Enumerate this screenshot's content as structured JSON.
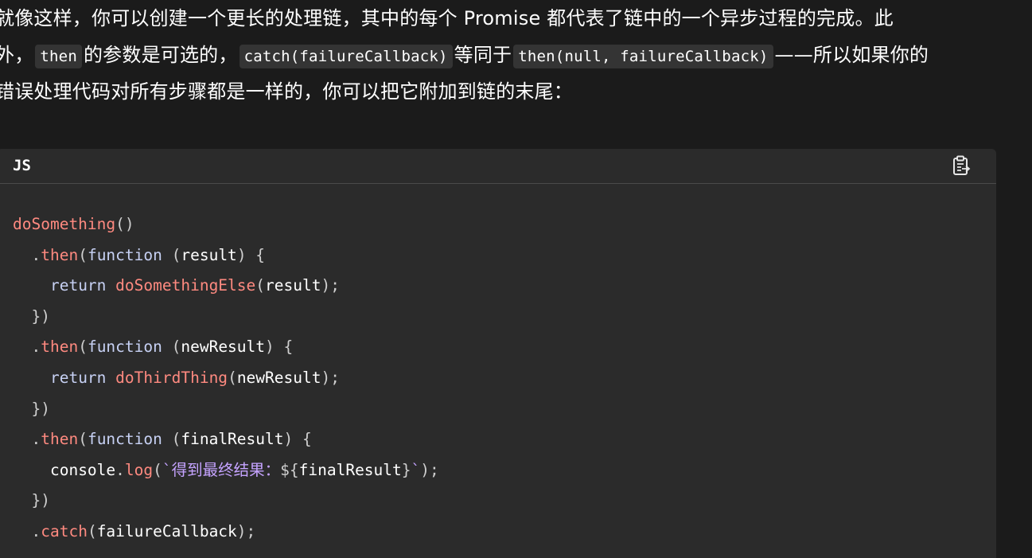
{
  "paragraph": {
    "line1": "就像这样，你可以创建一个更长的处理链，其中的每个 Promise 都代表了链中的一个异步过程的完成。此",
    "line2_pre": "外，",
    "line2_code1": "then",
    "line2_mid1": "的参数是可选的，",
    "line2_code2": "catch(failureCallback)",
    "line2_mid2": "等同于",
    "line2_code3": "then(null, failureCallback)",
    "line2_post": "——所以如果你的",
    "line3": "错误处理代码对所有步骤都是一样的，你可以把它附加到链的末尾："
  },
  "code_block": {
    "language_label": "JS",
    "copy_icon": "clipboard-copy-icon",
    "lines": [
      [
        {
          "t": "doSomething",
          "k": "fn"
        },
        {
          "t": "()",
          "k": "punc"
        }
      ],
      [
        {
          "t": "  .",
          "k": "punc"
        },
        {
          "t": "then",
          "k": "fn"
        },
        {
          "t": "(",
          "k": "punc"
        },
        {
          "t": "function",
          "k": "kw"
        },
        {
          "t": " (",
          "k": "punc"
        },
        {
          "t": "result",
          "k": "var"
        },
        {
          "t": ") {",
          "k": "punc"
        }
      ],
      [
        {
          "t": "    ",
          "k": "punc"
        },
        {
          "t": "return",
          "k": "kw"
        },
        {
          "t": " ",
          "k": "punc"
        },
        {
          "t": "doSomethingElse",
          "k": "fn"
        },
        {
          "t": "(",
          "k": "punc"
        },
        {
          "t": "result",
          "k": "var"
        },
        {
          "t": ");",
          "k": "punc"
        }
      ],
      [
        {
          "t": "  })",
          "k": "punc"
        }
      ],
      [
        {
          "t": "  .",
          "k": "punc"
        },
        {
          "t": "then",
          "k": "fn"
        },
        {
          "t": "(",
          "k": "punc"
        },
        {
          "t": "function",
          "k": "kw"
        },
        {
          "t": " (",
          "k": "punc"
        },
        {
          "t": "newResult",
          "k": "var"
        },
        {
          "t": ") {",
          "k": "punc"
        }
      ],
      [
        {
          "t": "    ",
          "k": "punc"
        },
        {
          "t": "return",
          "k": "kw"
        },
        {
          "t": " ",
          "k": "punc"
        },
        {
          "t": "doThirdThing",
          "k": "fn"
        },
        {
          "t": "(",
          "k": "punc"
        },
        {
          "t": "newResult",
          "k": "var"
        },
        {
          "t": ");",
          "k": "punc"
        }
      ],
      [
        {
          "t": "  })",
          "k": "punc"
        }
      ],
      [
        {
          "t": "  .",
          "k": "punc"
        },
        {
          "t": "then",
          "k": "fn"
        },
        {
          "t": "(",
          "k": "punc"
        },
        {
          "t": "function",
          "k": "kw"
        },
        {
          "t": " (",
          "k": "punc"
        },
        {
          "t": "finalResult",
          "k": "var"
        },
        {
          "t": ") {",
          "k": "punc"
        }
      ],
      [
        {
          "t": "    ",
          "k": "punc"
        },
        {
          "t": "console",
          "k": "var"
        },
        {
          "t": ".",
          "k": "punc"
        },
        {
          "t": "log",
          "k": "fn"
        },
        {
          "t": "(",
          "k": "punc"
        },
        {
          "t": "`得到最终结果：",
          "k": "str"
        },
        {
          "t": "${",
          "k": "punc"
        },
        {
          "t": "finalResult",
          "k": "var"
        },
        {
          "t": "}",
          "k": "punc"
        },
        {
          "t": "`",
          "k": "str"
        },
        {
          "t": ");",
          "k": "punc"
        }
      ],
      [
        {
          "t": "  })",
          "k": "punc"
        }
      ],
      [
        {
          "t": "  .",
          "k": "punc"
        },
        {
          "t": "catch",
          "k": "fn"
        },
        {
          "t": "(",
          "k": "punc"
        },
        {
          "t": "failureCallback",
          "k": "var"
        },
        {
          "t": ");",
          "k": "punc"
        }
      ]
    ]
  }
}
